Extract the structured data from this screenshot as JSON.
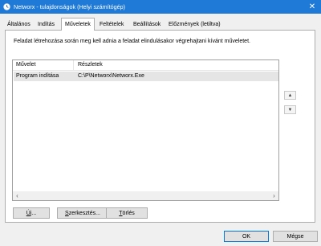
{
  "window": {
    "title": "Networx - tulajdonságok (Helyi számítógép)",
    "close_glyph": "✕"
  },
  "tabs": [
    {
      "label": "Általános"
    },
    {
      "label": "Indítás"
    },
    {
      "label": "Műveletek",
      "active": true
    },
    {
      "label": "Feltételek"
    },
    {
      "label": "Beállítások"
    },
    {
      "label": "Előzmények (letiltva)"
    }
  ],
  "panel": {
    "description": "Feladat létrehozása során meg kell adnia a feladat elindulásakor végrehajtani kívánt műveletet.",
    "columns": {
      "action": "Művelet",
      "details": "Részletek"
    },
    "rows": [
      {
        "action": "Program indítása",
        "details": "C:\\P\\Networx\\Networx.Exe"
      }
    ],
    "scroll_left": "‹",
    "scroll_right": "›",
    "move_up": "▲",
    "move_down": "▼"
  },
  "buttons": {
    "new": {
      "underline": "Ú",
      "rest": "j..."
    },
    "edit": {
      "underline": "S",
      "rest": "zerkesztés..."
    },
    "delete": {
      "underline": "T",
      "rest": "örlés"
    },
    "ok": "OK",
    "cancel": "Mégse"
  },
  "colors": {
    "titlebar": "#1f79d6",
    "selected_row": "#e5e5e5",
    "default_button_border": "#0078d7"
  }
}
